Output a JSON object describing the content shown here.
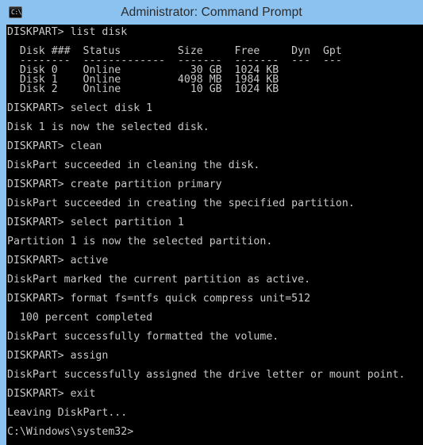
{
  "window": {
    "title": "Administrator: Command Prompt",
    "icon": "command-prompt-icon",
    "icon_glyph": "C:\\",
    "titlebar_color": "#8cc2f0",
    "console_background": "#000000",
    "console_foreground": "#c8c8c8"
  },
  "console": {
    "prompt": "DISKPART>",
    "final_prompt": "C:\\Windows\\system32>",
    "disk_table": {
      "headers": [
        "Disk ###",
        "Status",
        "Size",
        "Free",
        "Dyn",
        "Gpt"
      ],
      "separators": [
        "--------",
        "-------------",
        "--------",
        "--------",
        "---",
        "---"
      ],
      "rows": [
        {
          "disk": "Disk 0",
          "status": "Online",
          "size": "30 GB",
          "free": "1024 KB",
          "dyn": "",
          "gpt": ""
        },
        {
          "disk": "Disk 1",
          "status": "Online",
          "size": "4098 MB",
          "free": "1984 KB",
          "dyn": "",
          "gpt": ""
        },
        {
          "disk": "Disk 2",
          "status": "Online",
          "size": "10 GB",
          "free": "1024 KB",
          "dyn": "",
          "gpt": ""
        }
      ]
    },
    "commands": [
      "list disk",
      "select disk 1",
      "clean",
      "create partition primary",
      "select partition 1",
      "active",
      "format fs=ntfs quick compress unit=512",
      "assign",
      "exit"
    ],
    "lines": [
      "DISKPART> list disk",
      "",
      "  Disk ###  Status         Size     Free     Dyn  Gpt",
      "  --------  -------------  -------  -------  ---  ---",
      "  Disk 0    Online           30 GB  1024 KB",
      "  Disk 1    Online         4098 MB  1984 KB",
      "  Disk 2    Online           10 GB  1024 KB",
      "",
      "DISKPART> select disk 1",
      "",
      "Disk 1 is now the selected disk.",
      "",
      "DISKPART> clean",
      "",
      "DiskPart succeeded in cleaning the disk.",
      "",
      "DISKPART> create partition primary",
      "",
      "DiskPart succeeded in creating the specified partition.",
      "",
      "DISKPART> select partition 1",
      "",
      "Partition 1 is now the selected partition.",
      "",
      "DISKPART> active",
      "",
      "DiskPart marked the current partition as active.",
      "",
      "DISKPART> format fs=ntfs quick compress unit=512",
      "",
      "  100 percent completed",
      "",
      "DiskPart successfully formatted the volume.",
      "",
      "DISKPART> assign",
      "",
      "DiskPart successfully assigned the drive letter or mount point.",
      "",
      "DISKPART> exit",
      "",
      "Leaving DiskPart...",
      "",
      "C:\\Windows\\system32>"
    ]
  }
}
